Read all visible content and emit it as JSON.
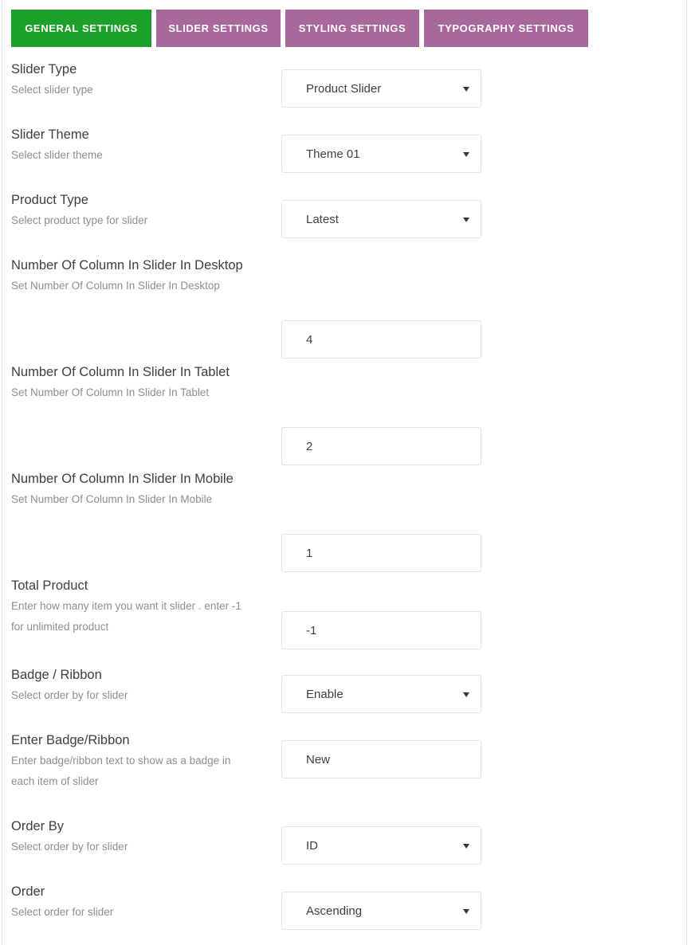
{
  "theme": {
    "active_tab_color": "#1ba02a",
    "inactive_tab_color": "#a8689b",
    "tab_text_color": "#ffffff",
    "label_color": "#3b4045",
    "description_color": "#8a8f94",
    "field_border_color": "#e2e4e6",
    "page_background": "#ffffff"
  },
  "tabs": [
    {
      "label": "GENERAL SETTINGS",
      "active": true
    },
    {
      "label": "SLIDER SETTINGS",
      "active": false
    },
    {
      "label": "STYLING SETTINGS",
      "active": false
    },
    {
      "label": "TYPOGRAPHY SETTINGS",
      "active": false
    }
  ],
  "fields": [
    {
      "label": "Slider Type",
      "description": "Select slider type",
      "control": "select",
      "value": "Product Slider",
      "icon": "chevron-down-icon"
    },
    {
      "label": "Slider Theme",
      "description": "Select slider theme",
      "control": "select",
      "value": "Theme 01",
      "icon": "chevron-down-icon"
    },
    {
      "label": "Product Type",
      "description": "Select product type for slider",
      "control": "select",
      "value": "Latest",
      "icon": "chevron-down-icon"
    },
    {
      "label": "Number Of Column In Slider In Desktop",
      "description": "Set Number Of Column In Slider In Desktop",
      "control": "text",
      "value": "4"
    },
    {
      "label": "Number Of Column In Slider In Tablet",
      "description": "Set Number Of Column In Slider In Tablet",
      "control": "text",
      "value": "2"
    },
    {
      "label": "Number Of Column In Slider In Mobile",
      "description": "Set Number Of Column In Slider In Mobile",
      "control": "text",
      "value": "1"
    },
    {
      "label": "Total Product",
      "description": "Enter how many item you want it slider . enter -1 for unlimited product",
      "control": "text",
      "value": "-1"
    },
    {
      "label": "Badge / Ribbon",
      "description": "Select order by for slider",
      "control": "select",
      "value": "Enable",
      "icon": "chevron-down-icon"
    },
    {
      "label": "Enter Badge/Ribbon",
      "description": "Enter badge/ribbon text to show as a badge in each item of slider",
      "control": "text",
      "value": "New"
    },
    {
      "label": "Order By",
      "description": "Select order by for slider",
      "control": "select",
      "value": "ID",
      "icon": "chevron-down-icon"
    },
    {
      "label": "Order",
      "description": "Select order for slider",
      "control": "select",
      "value": "Ascending",
      "icon": "chevron-down-icon"
    }
  ]
}
